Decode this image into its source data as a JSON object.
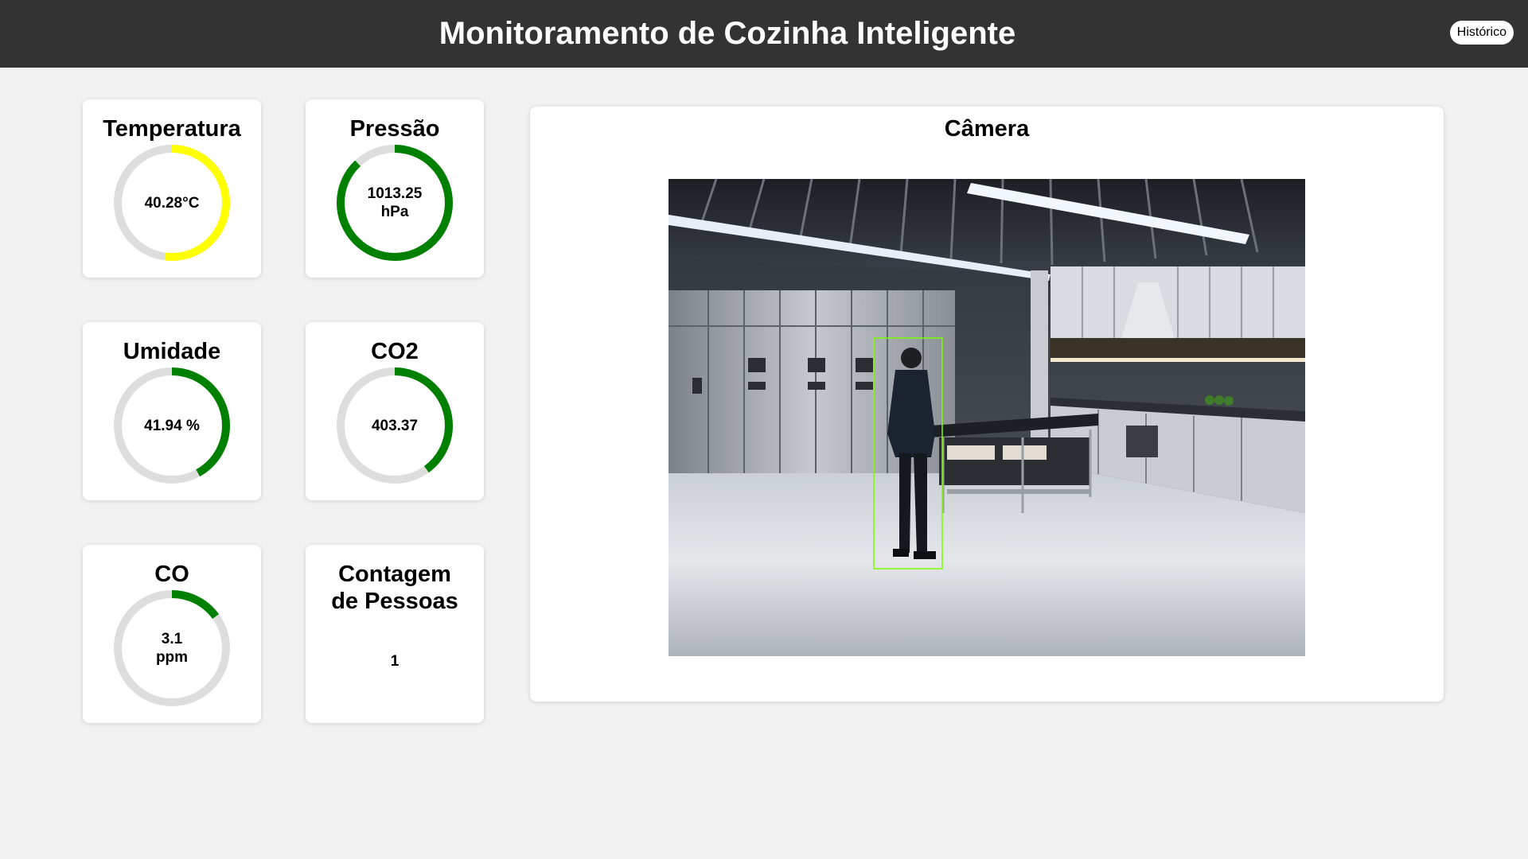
{
  "header": {
    "title": "Monitoramento de Cozinha Inteligente",
    "history_label": "Histórico"
  },
  "sensors": {
    "temperature": {
      "title": "Temperatura",
      "value": "40.28°C",
      "fraction": 0.52,
      "color": "#ffff00"
    },
    "pressure": {
      "title": "Pressão",
      "value_line1": "1013.25",
      "value_line2": "hPa",
      "fraction": 0.88,
      "color": "#008000"
    },
    "humidity": {
      "title": "Umidade",
      "value": "41.94 %",
      "fraction": 0.42,
      "color": "#008000"
    },
    "co2": {
      "title": "CO2",
      "value": "403.37",
      "fraction": 0.4,
      "color": "#008000"
    },
    "co": {
      "title": "CO",
      "value_line1": "3.1",
      "value_line2": "ppm",
      "fraction": 0.15,
      "color": "#008000"
    },
    "people_count": {
      "title_line1": "Contagem",
      "title_line2": "de Pessoas",
      "value": "1"
    }
  },
  "camera": {
    "title": "Câmera",
    "detection_color": "#7cfc00"
  },
  "colors": {
    "header_bg": "#333333",
    "page_bg": "#f2f2f2",
    "gauge_track": "#dddddd"
  }
}
